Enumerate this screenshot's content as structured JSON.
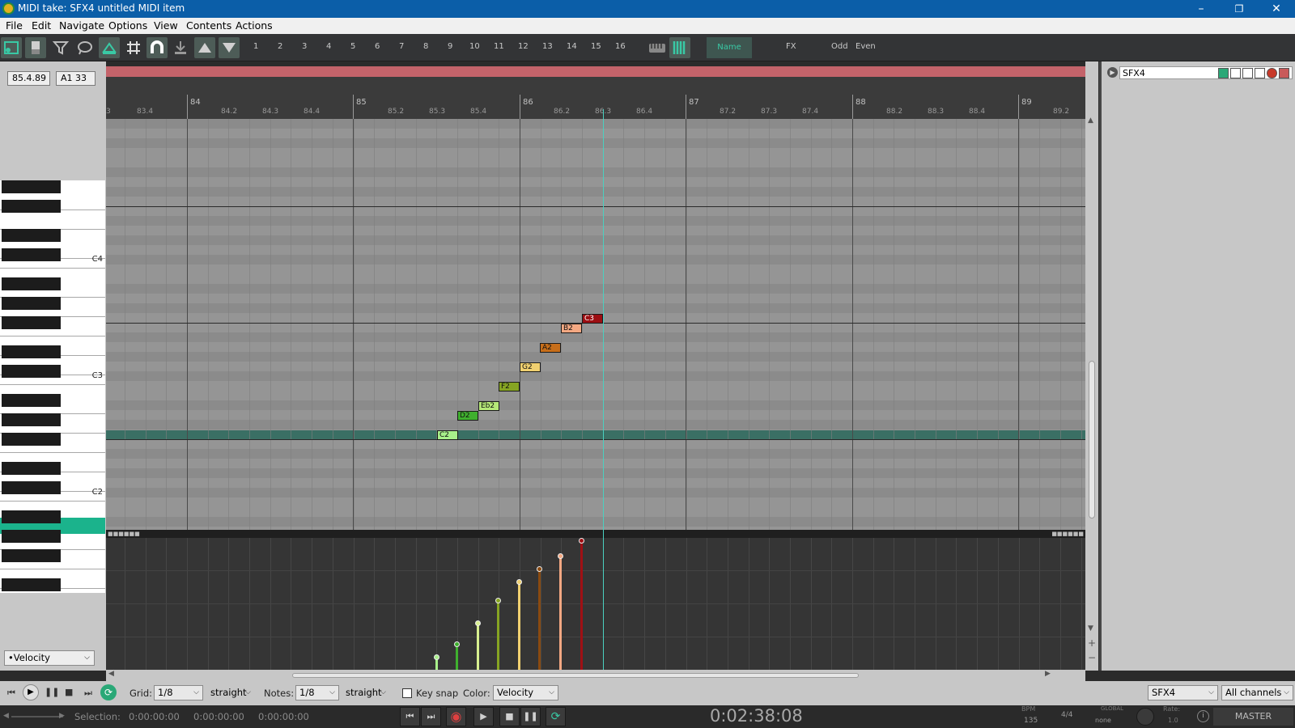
{
  "window": {
    "title": "MIDI take: SFX4 untitled MIDI item"
  },
  "menu": [
    "File",
    "Edit",
    "Navigate",
    "Options",
    "View",
    "Contents",
    "Actions"
  ],
  "toolbar": {
    "channels": [
      "1",
      "2",
      "3",
      "4",
      "5",
      "6",
      "7",
      "8",
      "9",
      "10",
      "11",
      "12",
      "13",
      "14",
      "15",
      "16"
    ],
    "name_label": "Name",
    "fx_label": "FX",
    "odd_label": "Odd",
    "even_label": "Even"
  },
  "position": {
    "time": "85.4.89",
    "note": "A1  33"
  },
  "piano": {
    "labels": [
      "C4",
      "C3",
      "C2"
    ]
  },
  "ruler": {
    "labels": [
      "3",
      "83.4",
      "84",
      "84.2",
      "84.3",
      "84.4",
      "85",
      "85.2",
      "85.3",
      "85.4",
      "86",
      "86.2",
      "86.3",
      "86.4",
      "87",
      "87.2",
      "87.3",
      "87.4",
      "88",
      "88.2",
      "88.3",
      "88.4",
      "89",
      "89.2"
    ]
  },
  "notes": [
    {
      "label": "C2",
      "color": "#a8f08a"
    },
    {
      "label": "D2",
      "color": "#3fb02e"
    },
    {
      "label": "Eb2",
      "color": "#b6e878"
    },
    {
      "label": "F2",
      "color": "#86a422"
    },
    {
      "label": "G2",
      "color": "#f0d070"
    },
    {
      "label": "A2",
      "color": "#c76e1a"
    },
    {
      "label": "B2",
      "color": "#f4a882"
    },
    {
      "label": "C3",
      "color": "#9c0e12"
    }
  ],
  "velocities": [
    {
      "value": 10,
      "color": "#a8f08a"
    },
    {
      "value": 20,
      "color": "#3fb02e"
    },
    {
      "value": 36,
      "color": "#d8f090"
    },
    {
      "value": 54,
      "color": "#86a422"
    },
    {
      "value": 68,
      "color": "#f0d070"
    },
    {
      "value": 78,
      "color": "#8a4a10"
    },
    {
      "value": 88,
      "color": "#f4a882"
    },
    {
      "value": 100,
      "color": "#a01014"
    }
  ],
  "track": {
    "name": "SFX4"
  },
  "lane": {
    "cc": "•Velocity"
  },
  "options": {
    "grid_label": "Grid:",
    "grid_value": "1/8",
    "grid_type": "straight",
    "notes_label": "Notes:",
    "notes_value": "1/8",
    "notes_type": "straight",
    "keysnap_label": "Key snap",
    "color_label": "Color:",
    "color_value": "Velocity",
    "track_value": "SFX4",
    "channels_value": "All channels"
  },
  "transport": {
    "selection_label": "Selection:",
    "sel_start": "0:00:00:00",
    "sel_end": "0:00:00:00",
    "sel_len": "0:00:00:00",
    "timecode": "0:02:38:08",
    "bpm_label": "BPM",
    "bpm": "135",
    "timesig": "4/4",
    "global_label": "GLOBAL",
    "global_value": "none",
    "rate_label": "Rate:",
    "rate_value": "1.0",
    "master": "MASTER"
  }
}
